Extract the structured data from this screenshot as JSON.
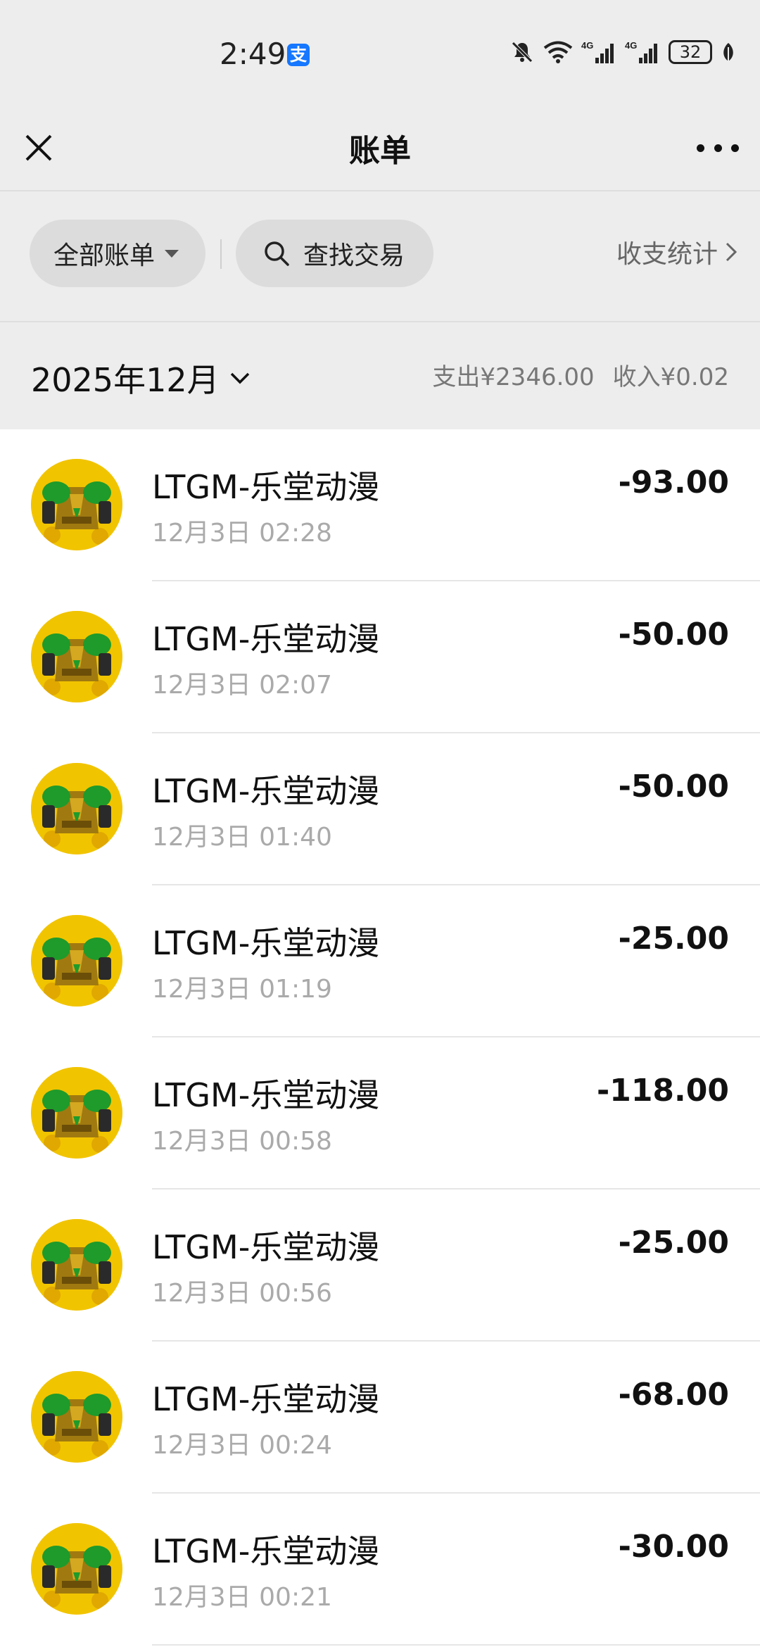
{
  "status_bar": {
    "time": "2:49",
    "pay_badge": "支",
    "network_1": "4G",
    "network_2": "4G",
    "battery": "32"
  },
  "header": {
    "title": "账单"
  },
  "filters": {
    "all_bills": "全部账单",
    "search": "查找交易",
    "stats": "收支统计"
  },
  "month_header": {
    "month": "2025年12月",
    "expense": "支出¥2346.00",
    "income": "收入¥0.02"
  },
  "transactions": [
    {
      "merchant": "LTGM-乐堂动漫",
      "time": "12月3日 02:28",
      "amount": "-93.00"
    },
    {
      "merchant": "LTGM-乐堂动漫",
      "time": "12月3日 02:07",
      "amount": "-50.00"
    },
    {
      "merchant": "LTGM-乐堂动漫",
      "time": "12月3日 01:40",
      "amount": "-50.00"
    },
    {
      "merchant": "LTGM-乐堂动漫",
      "time": "12月3日 01:19",
      "amount": "-25.00"
    },
    {
      "merchant": "LTGM-乐堂动漫",
      "time": "12月3日 00:58",
      "amount": "-118.00"
    },
    {
      "merchant": "LTGM-乐堂动漫",
      "time": "12月3日 00:56",
      "amount": "-25.00"
    },
    {
      "merchant": "LTGM-乐堂动漫",
      "time": "12月3日 00:24",
      "amount": "-68.00"
    },
    {
      "merchant": "LTGM-乐堂动漫",
      "time": "12月3日 00:21",
      "amount": "-30.00"
    }
  ],
  "colors": {
    "background": "#ededed",
    "list_background": "#ffffff",
    "alipay_blue": "#1677ff",
    "avatar_gold": "#f1c400",
    "avatar_green": "#1e9b2a"
  }
}
